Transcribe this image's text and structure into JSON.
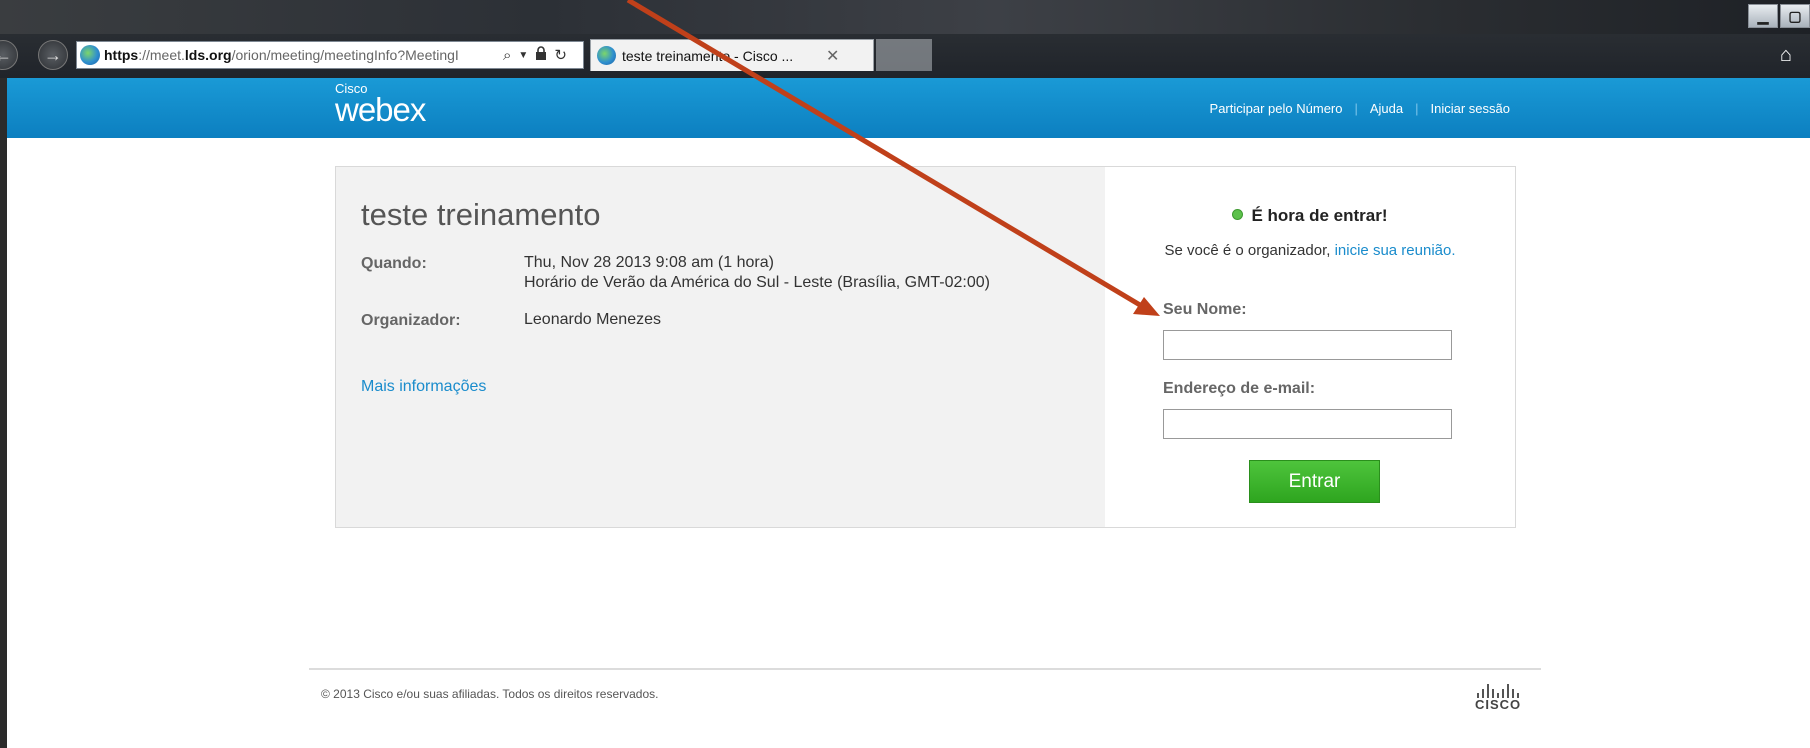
{
  "browser": {
    "url": {
      "scheme": "https",
      "separator": "://",
      "host_prefix": "meet.",
      "host_domain": "lds.org",
      "path": "/orion/meeting/meetingInfo?MeetingI"
    },
    "tab_title": "teste treinamento - Cisco ...",
    "icons": [
      "back-icon",
      "forward-icon",
      "globe-icon",
      "search-icon",
      "lock-icon",
      "refresh-icon",
      "close-icon",
      "home-icon",
      "minimize-icon",
      "maximize-icon"
    ]
  },
  "header": {
    "logo_cisco": "Cisco",
    "logo_webex": "webex",
    "nav": [
      "Participar pelo Número",
      "Ajuda",
      "Iniciar sessão"
    ],
    "nav_separator": "|"
  },
  "meeting": {
    "title": "teste treinamento",
    "when_label": "Quando:",
    "when_value_line1": "Thu, Nov 28 2013 9:08 am (1 hora)",
    "when_value_line2": "Horário de Verão da América do Sul - Leste (Brasília, GMT-02:00)",
    "organizer_label": "Organizador:",
    "organizer_value": "Leonardo Menezes",
    "more_info_link": "Mais informações"
  },
  "join": {
    "status": "É hora de entrar!",
    "host_text": "Se você é o organizador,",
    "host_link": "inicie sua reunião",
    "host_link_suffix": ".",
    "name_label": "Seu Nome:",
    "name_value": "",
    "email_label": "Endereço de e-mail:",
    "email_value": "",
    "enter_button": "Entrar"
  },
  "footer": {
    "copyright": "© 2013 Cisco e/ou suas afiliadas. Todos os direitos reservados.",
    "logo_text": "CISCO"
  },
  "colors": {
    "header_blue": "#0c7fc0",
    "link_blue": "#1a8ccc",
    "button_green": "#2ea51f",
    "status_dot_green": "#5cc14b",
    "annotation_arrow": "#c0401a"
  }
}
